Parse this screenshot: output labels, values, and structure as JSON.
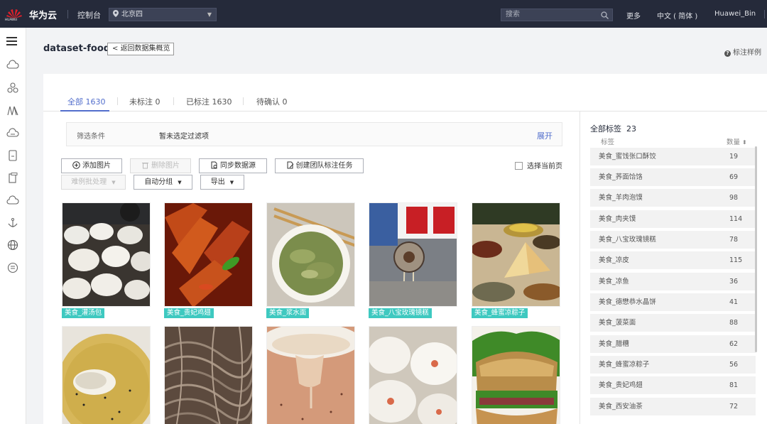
{
  "header": {
    "brand": "华为云",
    "logo_text": "HUAWEI",
    "console": "控制台",
    "region": "北京四",
    "search_placeholder": "搜索",
    "more": "更多",
    "language": "中文 ( 简体 )",
    "user": "Huawei_Bin"
  },
  "page": {
    "title": "dataset-food",
    "back_label": "返回数据集概览",
    "help_label": "标注样例"
  },
  "tabs": [
    {
      "label": "全部 1630",
      "active": true
    },
    {
      "label": "未标注 0"
    },
    {
      "label": "已标注 1630"
    },
    {
      "label": "待确认 0"
    }
  ],
  "filter": {
    "label": "筛选条件",
    "value": "暂未选定过滤项",
    "expand": "展开"
  },
  "toolbar": {
    "add_image": "添加图片",
    "delete_image": "删除图片",
    "sync_source": "同步数据源",
    "create_team_task": "创建团队标注任务",
    "select_page": "选择当前页",
    "hard_example": "难例批处理",
    "auto_group": "自动分组",
    "export": "导出"
  },
  "images": [
    {
      "tag": "美食_灌汤包",
      "icon": "soup-dumplings"
    },
    {
      "tag": "美食_贵妃鸡翅",
      "icon": "chicken-wings"
    },
    {
      "tag": "美食_浆水面",
      "icon": "noodles"
    },
    {
      "tag": "美食_八宝玫瑰镜糕",
      "icon": "rose-cake"
    },
    {
      "tag": "美食_蜂蜜凉粽子",
      "icon": "zongzi"
    },
    {
      "tag": "",
      "icon": "soup-bowl"
    },
    {
      "tag": "",
      "icon": "vermicelli"
    },
    {
      "tag": "",
      "icon": "porridge"
    },
    {
      "tag": "",
      "icon": "buns"
    },
    {
      "tag": "",
      "icon": "sandwich-bread"
    }
  ],
  "labels": {
    "title": "全部标签",
    "total": "23",
    "col_name": "标签",
    "col_count": "数量",
    "items": [
      {
        "name": "美食_蜜饯张口酥饺",
        "count": "19"
      },
      {
        "name": "美食_荞面饸饹",
        "count": "69"
      },
      {
        "name": "美食_羊肉泡馍",
        "count": "98"
      },
      {
        "name": "美食_肉夹馍",
        "count": "114"
      },
      {
        "name": "美食_八宝玫瑰镜糕",
        "count": "78"
      },
      {
        "name": "美食_凉皮",
        "count": "115"
      },
      {
        "name": "美食_凉鱼",
        "count": "36"
      },
      {
        "name": "美食_德懋恭水晶饼",
        "count": "41"
      },
      {
        "name": "美食_菠菜面",
        "count": "88"
      },
      {
        "name": "美食_腊糟",
        "count": "62"
      },
      {
        "name": "美食_蜂蜜凉粽子",
        "count": "56"
      },
      {
        "name": "美食_贵妃鸡翅",
        "count": "81"
      },
      {
        "name": "美食_西安油茶",
        "count": "72"
      }
    ]
  },
  "colors": {
    "topbar": "#252a3a",
    "accent": "#526ecc",
    "tag": "#3ec9c0"
  }
}
